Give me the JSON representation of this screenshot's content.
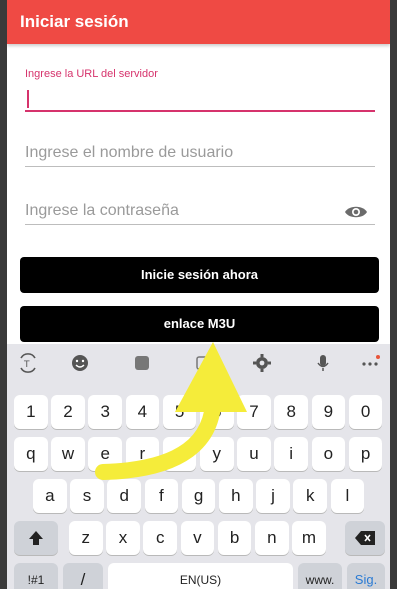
{
  "appbar": {
    "title": "Iniciar sesión",
    "color": "#ef4a44"
  },
  "form": {
    "url_label": "Ingrese la URL del servidor",
    "url_value": "",
    "username_placeholder": "Ingrese el nombre de usuario",
    "password_placeholder": "Ingrese la contraseña",
    "accent_color": "#d6336c"
  },
  "buttons": {
    "login": "Inicie sesión ahora",
    "m3u": "enlace M3U"
  },
  "keyboard": {
    "toolbar_icons": [
      "translate-icon",
      "emoji-icon",
      "sticker-icon",
      "gif-icon",
      "settings-icon",
      "microphone-icon",
      "more-icon"
    ],
    "number_row": [
      "1",
      "2",
      "3",
      "4",
      "5",
      "6",
      "7",
      "8",
      "9",
      "0"
    ],
    "row_q": [
      "q",
      "w",
      "e",
      "r",
      "t",
      "y",
      "u",
      "i",
      "o",
      "p"
    ],
    "row_a": [
      "a",
      "s",
      "d",
      "f",
      "g",
      "h",
      "j",
      "k",
      "l"
    ],
    "row_z": [
      "z",
      "x",
      "c",
      "v",
      "b",
      "n",
      "m"
    ],
    "bottom": {
      "symbols": "!#1",
      "comma": "/",
      "language": "EN(US)",
      "www": "www.",
      "action": "Sig."
    }
  },
  "overlay": {
    "arrow_color": "#f5ec3a"
  }
}
